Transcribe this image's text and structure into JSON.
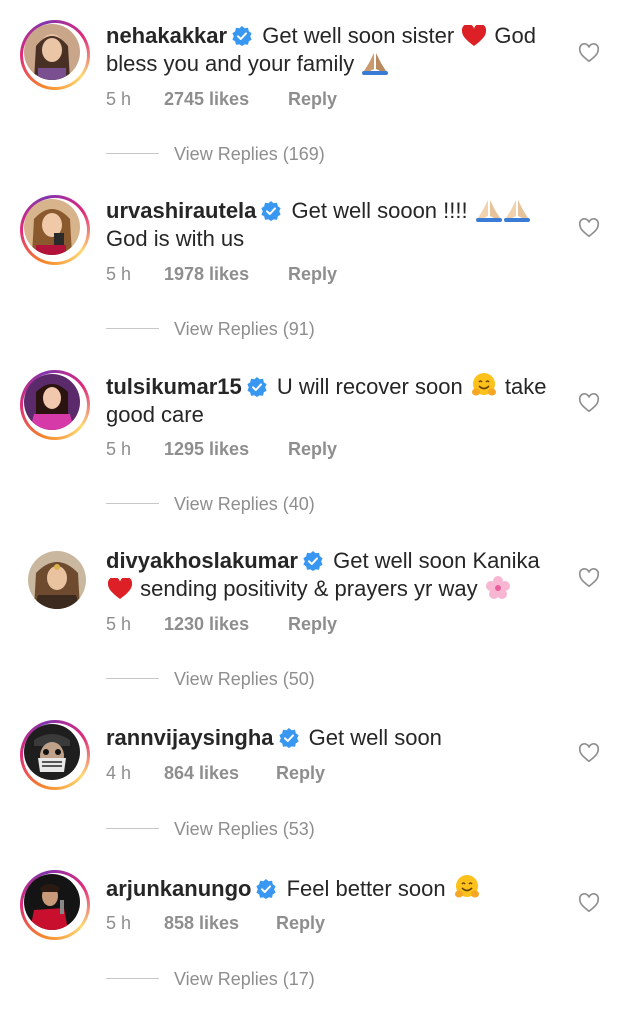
{
  "colors": {
    "verified_blue": "#3897f0",
    "text_primary": "#262626",
    "text_secondary": "#8e8e8e",
    "heart_red": "#ed4956"
  },
  "comments": [
    {
      "username": "nehakakkar",
      "text_part1": "Get well soon sister",
      "emoji1": "red-heart",
      "text_part2": "God bless you and your family",
      "emoji2": "folded-hands",
      "time": "5 h",
      "likes": "2745 likes",
      "reply": "Reply",
      "view_replies": "View Replies (169)"
    },
    {
      "username": "urvashirautela",
      "text_part1": "Get well sooon !!!!",
      "emoji1": "folded-hands-x2",
      "text_part2": "God is with us",
      "time": "5 h",
      "likes": "1978 likes",
      "reply": "Reply",
      "view_replies": "View Replies (91)"
    },
    {
      "username": "tulsikumar15",
      "text_part1": "U will recover soon",
      "emoji1": "hugging-face",
      "text_part2": "take good care",
      "time": "5 h",
      "likes": "1295 likes",
      "reply": "Reply",
      "view_replies": "View Replies (40)"
    },
    {
      "username": "divyakhoslakumar",
      "text_part1": "Get well soon Kanika",
      "emoji1": "red-heart",
      "text_part2": "sending positivity & prayers yr way",
      "emoji2": "cherry-blossom",
      "time": "5 h",
      "likes": "1230 likes",
      "reply": "Reply",
      "view_replies": "View Replies (50)"
    },
    {
      "username": "rannvijaysingha",
      "text_part1": "Get well soon",
      "time": "4 h",
      "likes": "864 likes",
      "reply": "Reply",
      "view_replies": "View Replies (53)"
    },
    {
      "username": "arjunkanungo",
      "text_part1": "Feel better soon",
      "emoji1": "hugging-face",
      "time": "5 h",
      "likes": "858 likes",
      "reply": "Reply",
      "view_replies": "View Replies (17)"
    }
  ]
}
